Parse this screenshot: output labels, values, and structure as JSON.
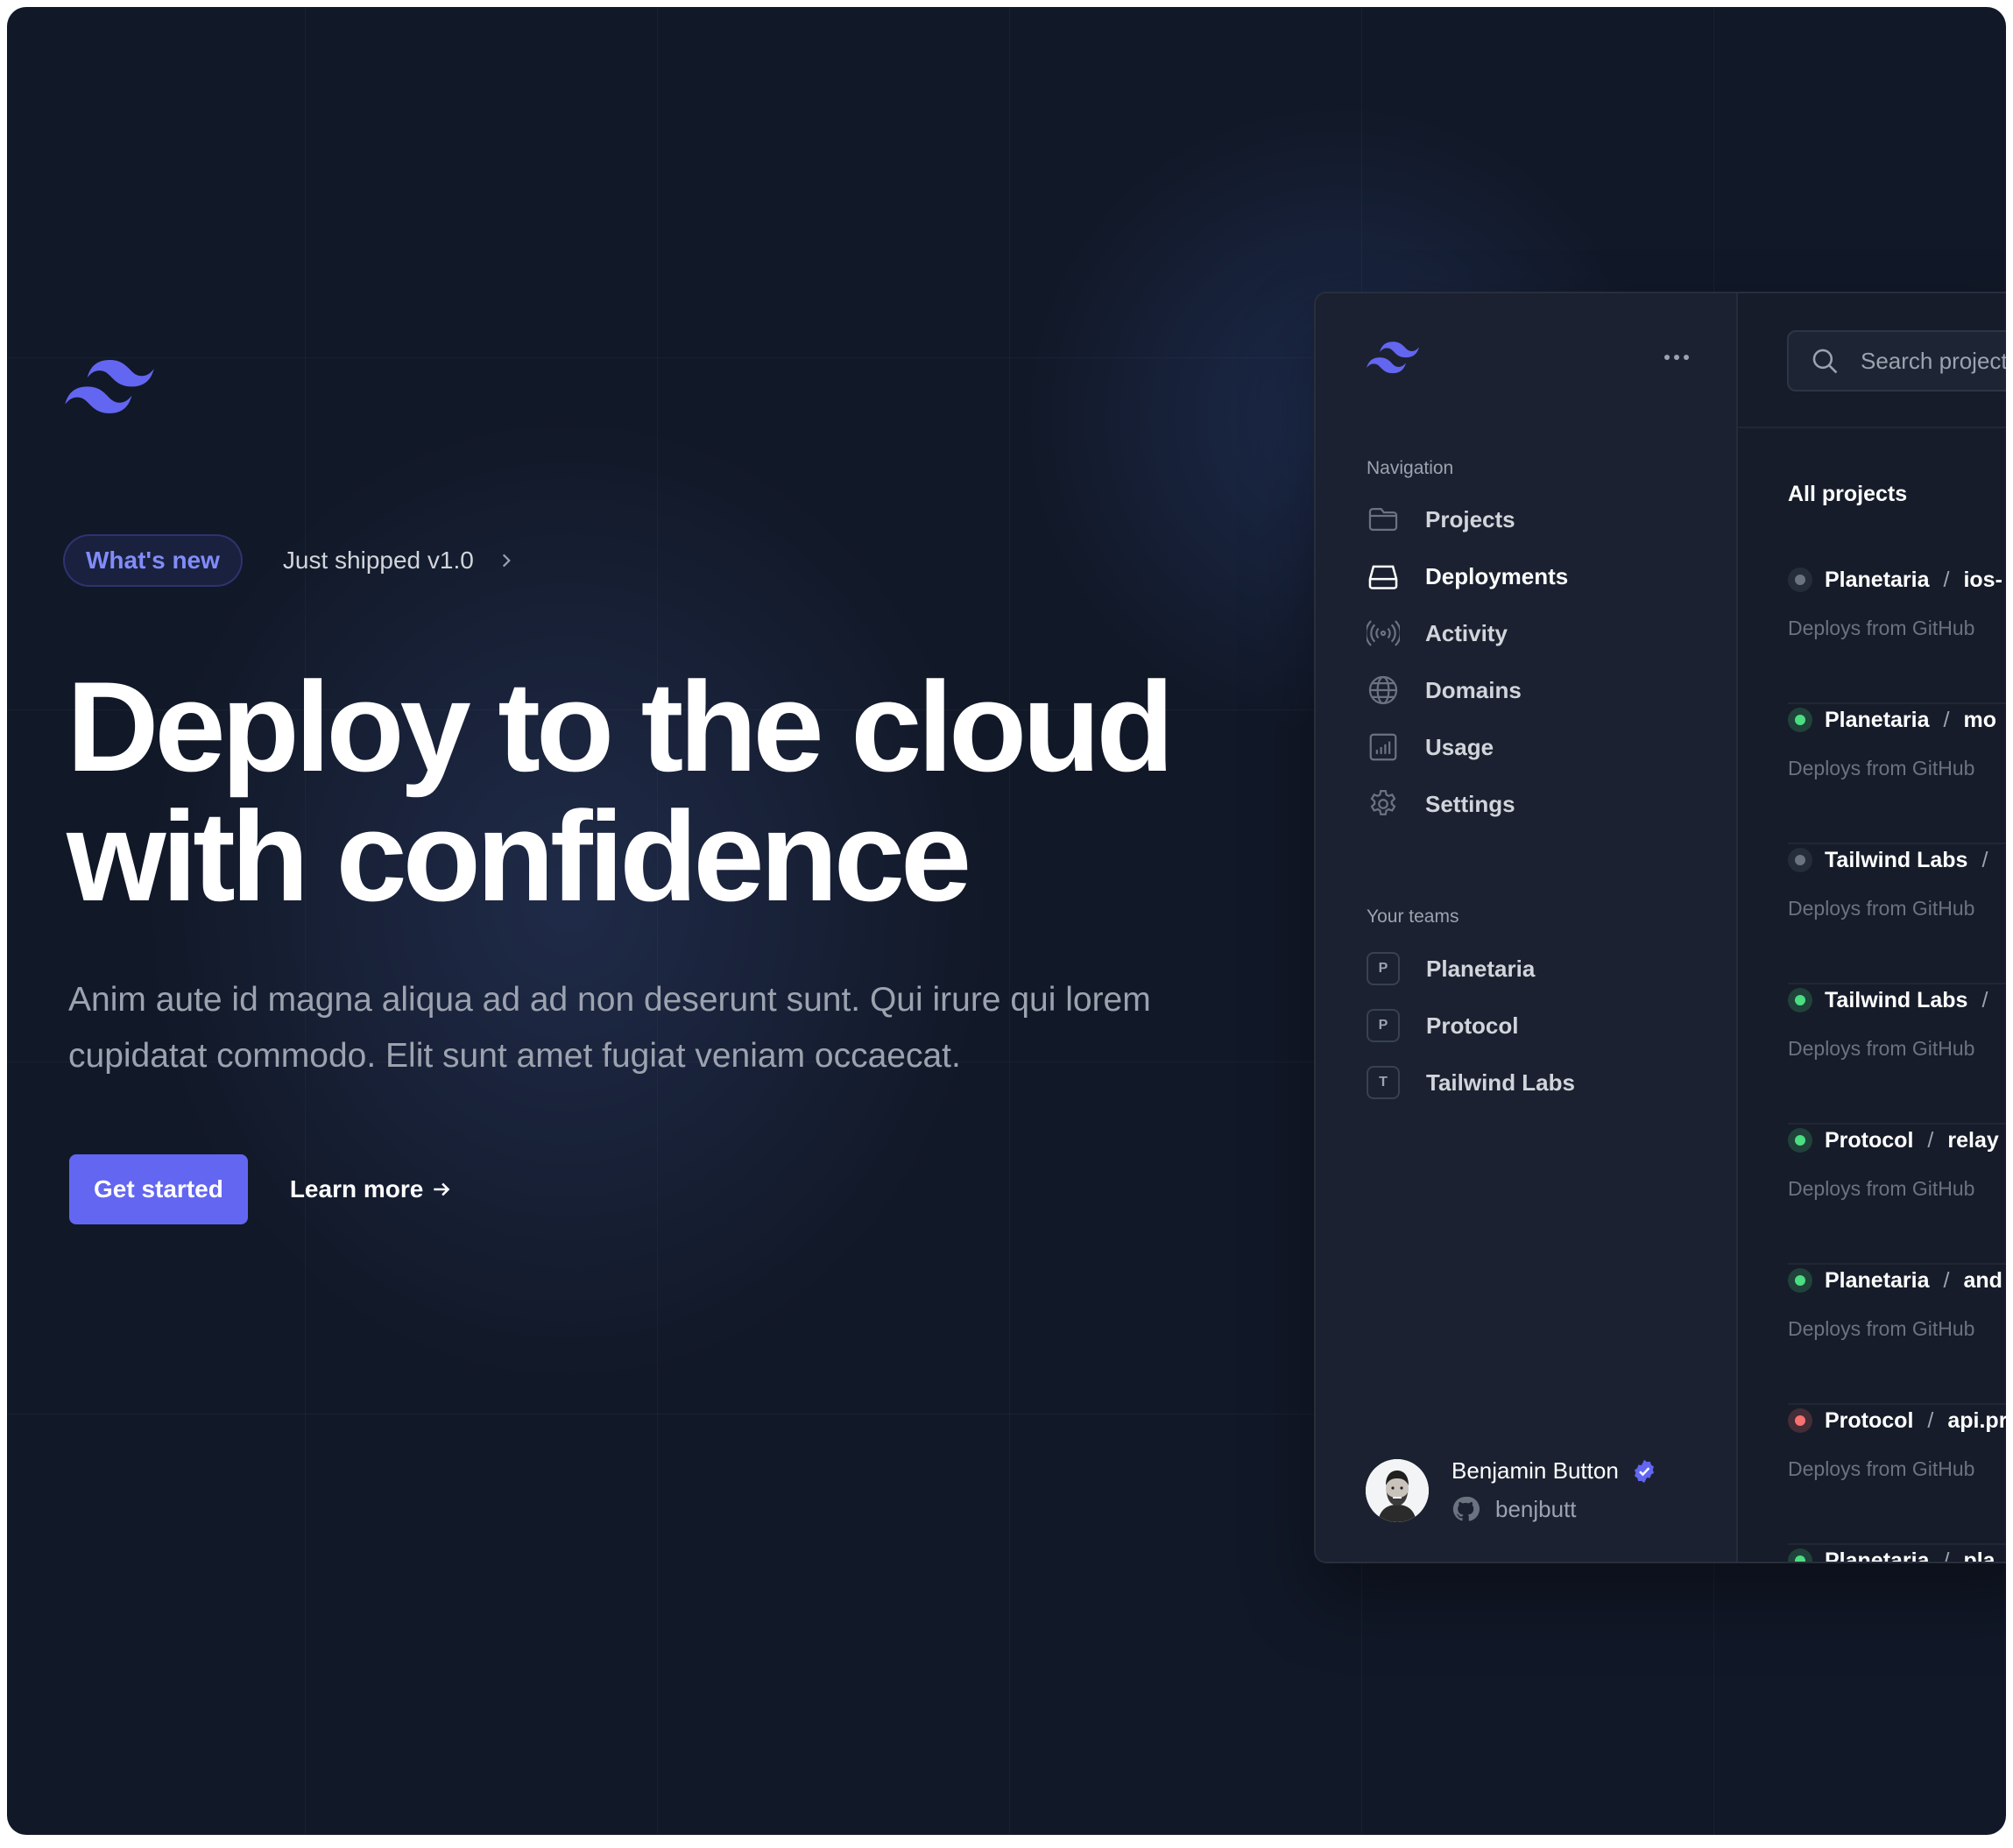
{
  "hero": {
    "badge": "What's new",
    "announcement": "Just shipped v1.0",
    "headline_line1": "Deploy to the cloud",
    "headline_line2": "with confidence",
    "subtitle": "Anim aute id magna aliqua ad ad non deserunt sunt. Qui irure qui lorem cupidatat commodo. Elit sunt amet fugiat veniam occaecat.",
    "primary_cta": "Get started",
    "secondary_cta": "Learn more"
  },
  "colors": {
    "background": "#111827",
    "accent": "#6366f1",
    "accent_light": "#818cf8",
    "status_active": "#4ade80",
    "status_inactive": "#6b7280",
    "status_error": "#f87171"
  },
  "sidebar": {
    "navigation_heading": "Navigation",
    "items": [
      {
        "label": "Projects",
        "icon": "folder-icon"
      },
      {
        "label": "Deployments",
        "icon": "server-icon",
        "active": true
      },
      {
        "label": "Activity",
        "icon": "signal-icon"
      },
      {
        "label": "Domains",
        "icon": "globe-icon"
      },
      {
        "label": "Usage",
        "icon": "chart-bar-icon"
      },
      {
        "label": "Settings",
        "icon": "gear-icon"
      }
    ],
    "teams_heading": "Your teams",
    "teams": [
      {
        "initial": "P",
        "name": "Planetaria"
      },
      {
        "initial": "P",
        "name": "Protocol"
      },
      {
        "initial": "T",
        "name": "Tailwind Labs"
      }
    ],
    "user": {
      "name": "Benjamin Button",
      "handle": "benjbutt"
    }
  },
  "main": {
    "search_placeholder": "Search projects",
    "title": "All projects",
    "projects": [
      {
        "team": "Planetaria",
        "name": "ios-",
        "status": "inactive",
        "source": "Deploys from GitHub"
      },
      {
        "team": "Planetaria",
        "name": "mo",
        "status": "active",
        "source": "Deploys from GitHub"
      },
      {
        "team": "Tailwind Labs",
        "name": "",
        "status": "inactive",
        "source": "Deploys from GitHub"
      },
      {
        "team": "Tailwind Labs",
        "name": "",
        "status": "active",
        "source": "Deploys from GitHub"
      },
      {
        "team": "Protocol",
        "name": "relay",
        "status": "active",
        "source": "Deploys from GitHub"
      },
      {
        "team": "Planetaria",
        "name": "and",
        "status": "active",
        "source": "Deploys from GitHub"
      },
      {
        "team": "Protocol",
        "name": "api.pr",
        "status": "error",
        "source": "Deploys from GitHub"
      },
      {
        "team": "Planetaria",
        "name": "pla",
        "status": "active",
        "source": ""
      }
    ]
  }
}
